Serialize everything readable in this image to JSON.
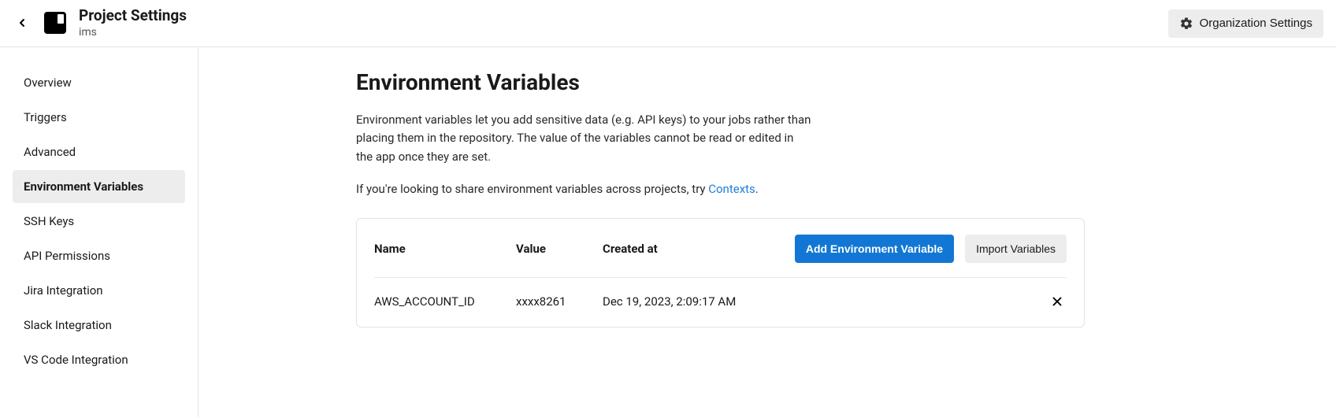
{
  "header": {
    "title": "Project Settings",
    "subtitle": "ims",
    "org_button": "Organization Settings"
  },
  "sidebar": {
    "items": [
      {
        "label": "Overview",
        "active": false
      },
      {
        "label": "Triggers",
        "active": false
      },
      {
        "label": "Advanced",
        "active": false
      },
      {
        "label": "Environment Variables",
        "active": true
      },
      {
        "label": "SSH Keys",
        "active": false
      },
      {
        "label": "API Permissions",
        "active": false
      },
      {
        "label": "Jira Integration",
        "active": false
      },
      {
        "label": "Slack Integration",
        "active": false
      },
      {
        "label": "VS Code Integration",
        "active": false
      }
    ]
  },
  "main": {
    "title": "Environment Variables",
    "description": "Environment variables let you add sensitive data (e.g. API keys) to your jobs rather than placing them in the repository. The value of the variables cannot be read or edited in the app once they are set.",
    "contexts_prefix": "If you're looking to share environment variables across projects, try ",
    "contexts_link": "Contexts",
    "contexts_suffix": ".",
    "columns": {
      "name": "Name",
      "value": "Value",
      "created": "Created at"
    },
    "actions": {
      "add": "Add Environment Variable",
      "import": "Import Variables"
    },
    "rows": [
      {
        "name": "AWS_ACCOUNT_ID",
        "value": "xxxx8261",
        "created": "Dec 19, 2023, 2:09:17 AM"
      }
    ]
  }
}
